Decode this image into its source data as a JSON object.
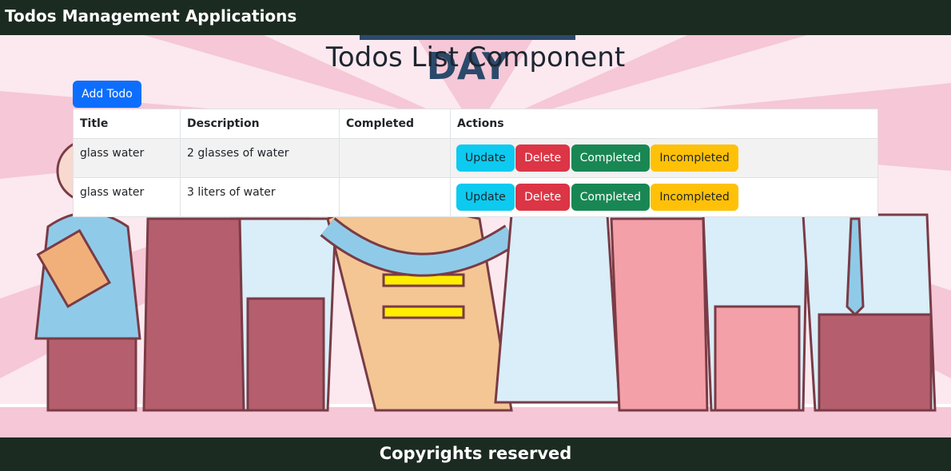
{
  "navbar": {
    "title": "Todos Management Applications"
  },
  "page": {
    "heading": "Todos List Component",
    "add_button": "Add Todo"
  },
  "table": {
    "headers": [
      "Title",
      "Description",
      "Completed",
      "Actions"
    ],
    "rows": [
      {
        "title": "glass water",
        "description": "2 glasses of water",
        "completed": ""
      },
      {
        "title": "glass water",
        "description": "3 liters of water",
        "completed": ""
      }
    ],
    "actions": {
      "update": "Update",
      "delete": "Delete",
      "completed": "Completed",
      "incompleted": "Incompleted"
    }
  },
  "footer": {
    "text": "Copyrights reserved"
  },
  "colors": {
    "nav": "#1c2b21",
    "primary": "#0d6efd",
    "info": "#0dcaf0",
    "danger": "#dc3545",
    "success": "#198754",
    "warning": "#ffc107"
  }
}
